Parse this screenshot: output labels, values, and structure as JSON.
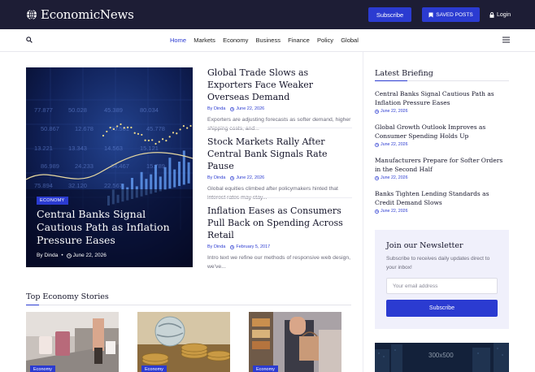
{
  "header": {
    "logo_text": "EconomicNews",
    "subscribe_label": "Subscribe",
    "saved_posts_label": "SAVED POSTS",
    "login_label": "Login"
  },
  "nav": {
    "links": [
      "Home",
      "Markets",
      "Economy",
      "Business",
      "Finance",
      "Policy",
      "Global"
    ],
    "active": "Home"
  },
  "hero": {
    "category": "ECONOMY",
    "title": "Central Banks Signal Cautious Path as Inflation Pressure Eases",
    "author": "By Dinda",
    "date": "June 22, 2026",
    "chart_numbers": [
      "77.877",
      "50.028",
      "45.389",
      "80.034",
      "50.867",
      "12.678",
      "70.501",
      "45.778",
      "13.221",
      "13.343",
      "14.563",
      "15.121",
      "86.989",
      "24.233",
      "34.467",
      "15.789",
      "75.894",
      "32.120",
      "22.567"
    ]
  },
  "articles": [
    {
      "title": "Global Trade Slows as Exporters Face Weaker Overseas Demand",
      "author": "By Dinda",
      "date": "June 22, 2026",
      "excerpt": "Exporters are adjusting forecasts as softer demand, higher shipping costs, and..."
    },
    {
      "title": "Stock Markets Rally After Central Bank Signals Rate Pause",
      "author": "By Dinda",
      "date": "June 22, 2026",
      "excerpt": "Global equities climbed after policymakers hinted that interest rates may stay..."
    },
    {
      "title": "Inflation Eases as Consumers Pull Back on Spending Across Retail",
      "author": "By Dinda",
      "date": "February 5, 2017",
      "excerpt": "Intro text we refine our methods of responsive web design, we've..."
    }
  ],
  "latest_briefing": {
    "heading": "Latest Briefing",
    "items": [
      {
        "title": "Central Banks Signal Cautious Path as Inflation Pressure Eases",
        "date": "June 22, 2026"
      },
      {
        "title": "Global Growth Outlook Improves as Consumer Spending Holds Up",
        "date": "June 22, 2026"
      },
      {
        "title": "Manufacturers Prepare for Softer Orders in the Second Half",
        "date": "June 22, 2026"
      },
      {
        "title": "Banks Tighten Lending Standards as Credit Demand Slows",
        "date": "June 22, 2026"
      }
    ]
  },
  "newsletter": {
    "title": "Join our Newsletter",
    "description": "Subscribe to receives daily updates direct to your inbox!",
    "email_placeholder": "Your email address",
    "button_label": "Subscribe"
  },
  "ad": {
    "label": "300x500"
  },
  "top_stories": {
    "heading": "Top Economy Stories",
    "cards": [
      {
        "category": "Economy"
      },
      {
        "category": "Economy"
      },
      {
        "category": "Economy"
      }
    ]
  },
  "colors": {
    "header_bg": "#1d1d35",
    "accent": "#2b3bd1",
    "newsletter_bg": "#f0f0fb"
  },
  "icons": [
    "globe-icon",
    "bookmark-icon",
    "lock-icon",
    "search-icon",
    "menu-icon",
    "clock-icon"
  ]
}
